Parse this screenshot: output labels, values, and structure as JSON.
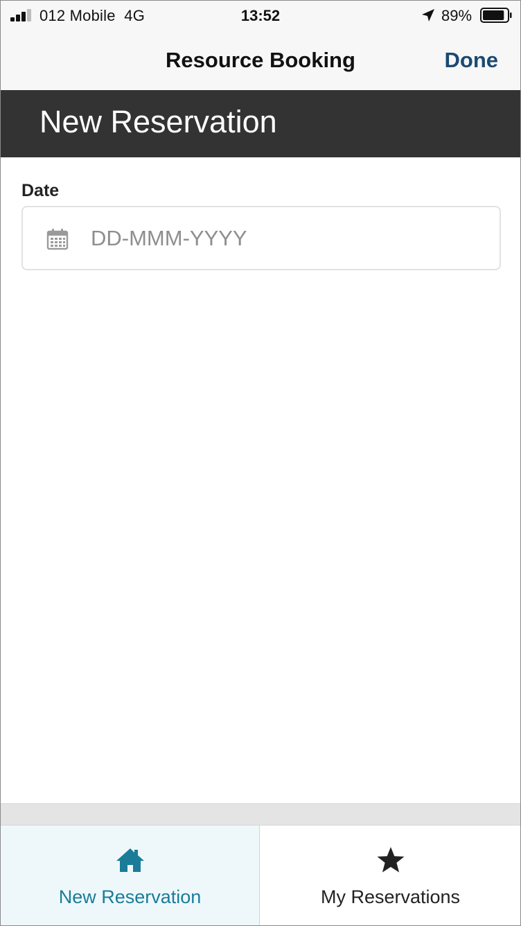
{
  "status_bar": {
    "carrier": "012 Mobile",
    "network": "4G",
    "time": "13:52",
    "battery_percent": "89%",
    "battery_level": 0.89
  },
  "nav": {
    "title": "Resource Booking",
    "done_label": "Done"
  },
  "header": {
    "title": "New Reservation"
  },
  "form": {
    "date_label": "Date",
    "date_placeholder": "DD-MMM-YYYY",
    "date_value": ""
  },
  "tabs": [
    {
      "label": "New Reservation",
      "icon": "home-icon",
      "active": true
    },
    {
      "label": "My Reservations",
      "icon": "star-icon",
      "active": false
    }
  ],
  "colors": {
    "header_bg": "#333333",
    "done_link": "#1b4a73",
    "active_tab_text": "#1a7c98",
    "active_tab_bg": "#eef8fb"
  }
}
